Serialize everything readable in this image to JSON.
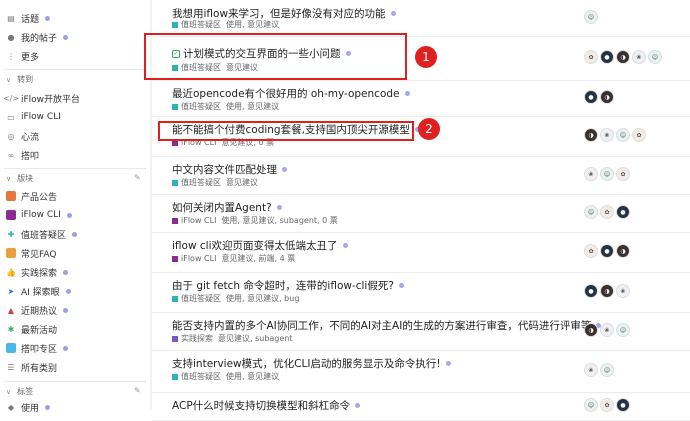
{
  "sidebar": {
    "top_items": [
      {
        "label": "话题",
        "icon": "topics-icon",
        "unread": true
      },
      {
        "label": "我的帖子",
        "icon": "user-icon",
        "unread": true
      },
      {
        "label": "更多",
        "icon": "more-icon",
        "unread": false
      }
    ],
    "section_links": {
      "title": "转到",
      "items": [
        {
          "label": "iFlow开放平台",
          "icon": "code-icon"
        },
        {
          "label": "iFlow CLI",
          "icon": "terminal-icon"
        },
        {
          "label": "心流",
          "icon": "target-icon"
        },
        {
          "label": "搭叩",
          "icon": "link-icon"
        }
      ]
    },
    "section_categories": {
      "title": "版块",
      "items": [
        {
          "label": "产品公告",
          "color": "#e8763c",
          "unread": false
        },
        {
          "label": "iFlow CLI",
          "color": "#8b2a8f",
          "unread": true
        },
        {
          "label": "值班答疑区",
          "color": "#2bb5b0",
          "unread": true
        },
        {
          "label": "常见FAQ",
          "color": "#e8a040",
          "unread": false
        },
        {
          "label": "实践探索",
          "color": "#7a55c8",
          "unread": true
        },
        {
          "label": "AI 探索眼",
          "color": "#2d6fd8",
          "unread": true
        },
        {
          "label": "近期热议",
          "color": "#d84040",
          "unread": true
        },
        {
          "label": "最新活动",
          "color": "#2db06a",
          "unread": false
        },
        {
          "label": "搭叩专区",
          "color": "#49b8e8",
          "unread": true
        },
        {
          "label": "所有类别",
          "color": "#888888",
          "unread": false
        }
      ]
    },
    "section_tags": {
      "title": "标签",
      "items": [
        {
          "label": "使用",
          "unread": true
        }
      ]
    }
  },
  "topics": [
    {
      "title": "我想用iflow来学习，但是好像没有对应的功能",
      "category": "值班答疑区",
      "cat_color": "#2bb5b0",
      "tags": "使用, 意见建议",
      "solved": false,
      "avatars": 1
    },
    {
      "title": "计划模式的交互界面的一些小问题",
      "category": "值班答疑区",
      "cat_color": "#2bb5b0",
      "tags": "意见建议",
      "solved": true,
      "avatars": 5
    },
    {
      "title": "最近opencode有个很好用的 oh-my-opencode",
      "category": "值班答疑区",
      "cat_color": "#2bb5b0",
      "tags": "使用, 意见建议",
      "solved": false,
      "avatars": 2
    },
    {
      "title": "能不能搞个付费coding套餐,支持国内顶尖开源模型",
      "category": "iFlow CLI",
      "cat_color": "#8b2a8f",
      "tags": "意见建议, 0 票",
      "solved": false,
      "avatars": 4
    },
    {
      "title": "中文内容文件匹配处理",
      "category": "值班答疑区",
      "cat_color": "#2bb5b0",
      "tags": "意见建议",
      "solved": false,
      "avatars": 3
    },
    {
      "title": "如何关闭内置Agent?",
      "category": "iFlow CLI",
      "cat_color": "#8b2a8f",
      "tags": "使用, 意见建议, subagent, 0 票",
      "solved": false,
      "avatars": 3
    },
    {
      "title": "iflow cli欢迎页面变得太低端太丑了",
      "category": "iFlow CLI",
      "cat_color": "#8b2a8f",
      "tags": "意见建议, 前端, 4 票",
      "solved": false,
      "avatars": 3
    },
    {
      "title": "由于 git fetch 命令超时，连带的iflow-cli假死?",
      "category": "值班答疑区",
      "cat_color": "#2bb5b0",
      "tags": "使用, 意见建议, bug",
      "solved": false,
      "avatars": 3
    },
    {
      "title": "能否支持内置的多个AI协同工作，不同的AI对主AI的生成的方案进行审查，代码进行评审等",
      "category": "实践探索",
      "cat_color": "#7a55c8",
      "tags": "意见建议, subagent",
      "solved": false,
      "avatars": 3
    },
    {
      "title": "支持interview模式，优化CLI启动的服务显示及命令执行!",
      "category": "值班答疑区",
      "cat_color": "#2bb5b0",
      "tags": "使用, 意见建议",
      "solved": false,
      "avatars": 2
    },
    {
      "title": "ACP什么时候支持切换模型和斜杠命令",
      "category": "",
      "cat_color": "#2bb5b0",
      "tags": "",
      "solved": false,
      "avatars": 3
    }
  ],
  "annotations": [
    {
      "number": "1"
    },
    {
      "number": "2"
    }
  ]
}
